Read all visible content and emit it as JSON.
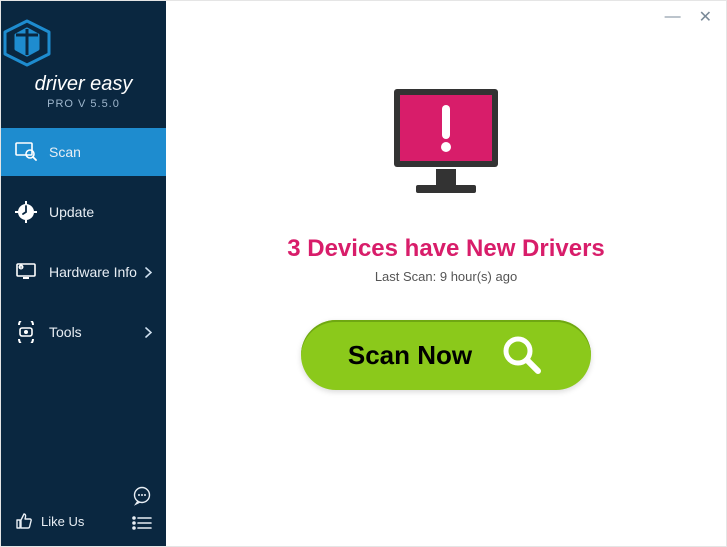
{
  "brand": {
    "name": "driver easy",
    "version": "PRO V 5.5.0"
  },
  "sidebar": {
    "items": [
      {
        "label": "Scan"
      },
      {
        "label": "Update"
      },
      {
        "label": "Hardware Info"
      },
      {
        "label": "Tools"
      }
    ],
    "like_us": "Like Us"
  },
  "main": {
    "headline": "3 Devices have New Drivers",
    "lastscan": "Last Scan: 9 hour(s) ago",
    "scan_button": "Scan Now"
  },
  "titlebar": {
    "minimize": "—",
    "close": "✕"
  }
}
